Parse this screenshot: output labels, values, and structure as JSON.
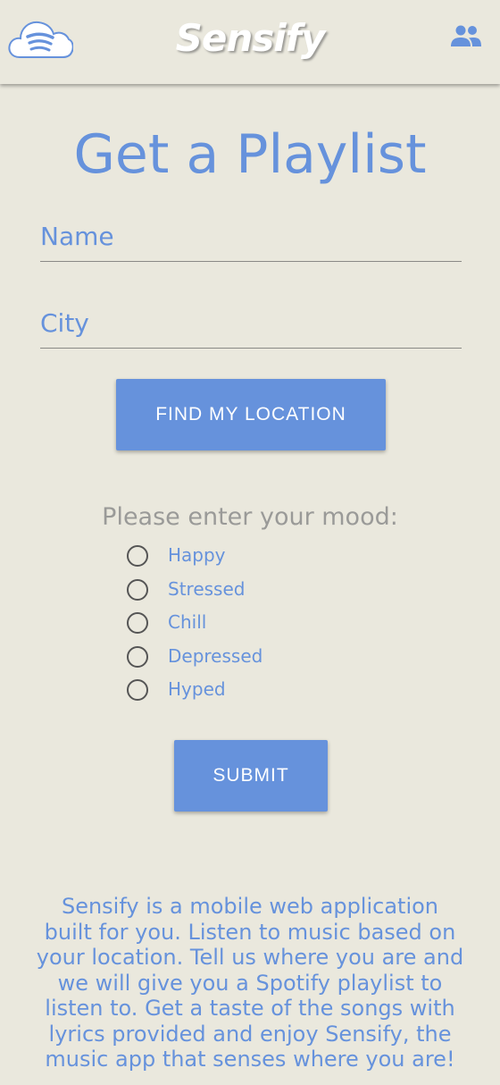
{
  "header": {
    "brand": "Sensify",
    "logo_icon": "cloud-spotify-icon",
    "profile_icon": "people-icon"
  },
  "main": {
    "title": "Get a Playlist",
    "name_placeholder": "Name",
    "city_placeholder": "City",
    "find_location_label": "FIND MY LOCATION",
    "mood_prompt": "Please enter your mood:",
    "moods": [
      "Happy",
      "Stressed",
      "Chill",
      "Depressed",
      "Hyped"
    ],
    "submit_label": "SUBMIT"
  },
  "about": {
    "text": "Sensify is a mobile web application built for you. Listen to music based on your location. Tell us where you are and we will give you a Spotify playlist to listen to. Get a taste of the songs with lyrics provided and enjoy Sensify, the music app that senses where you are!"
  },
  "colors": {
    "background": "#eae8dd",
    "accent": "#6692dc",
    "muted": "#9a9a98"
  }
}
